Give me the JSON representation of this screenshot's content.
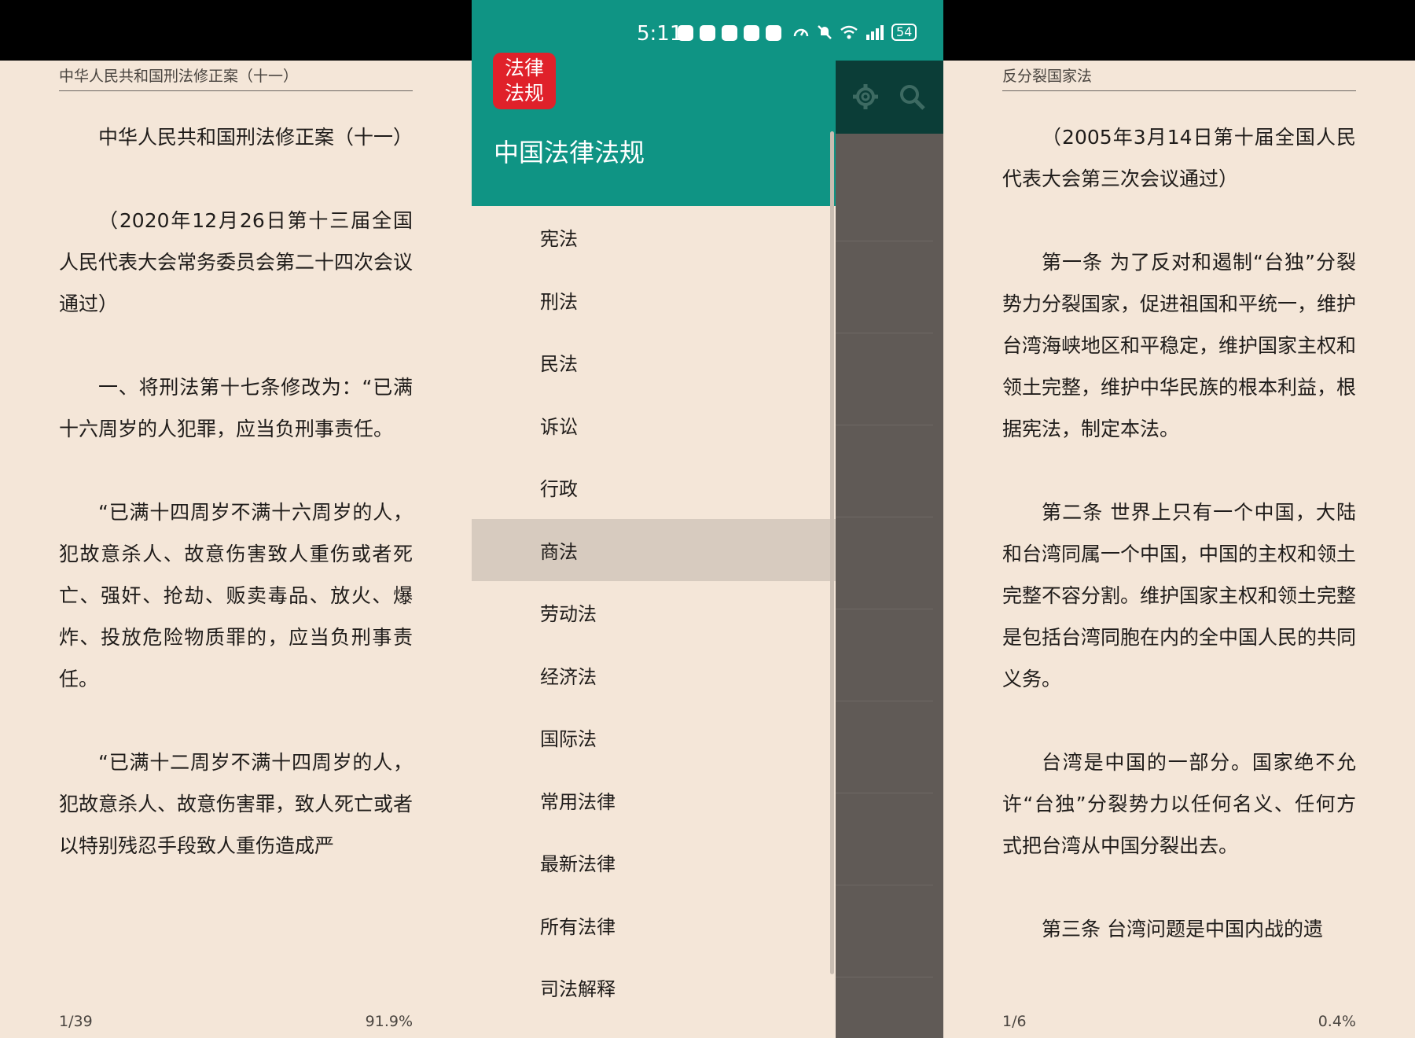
{
  "left_reader": {
    "running_title": "中华人民共和国刑法修正案（十一）",
    "paragraphs": [
      "中华人民共和国刑法修正案（十一）",
      "（2020年12月26日第十三届全国人民代表大会常务委员会第二十四次会议通过）",
      "一、将刑法第十七条修改为：“已满十六周岁的人犯罪，应当负刑事责任。",
      "“已满十四周岁不满十六周岁的人，犯故意杀人、故意伤害致人重伤或者死亡、强奸、抢劫、贩卖毒品、放火、爆炸、投放危险物质罪的，应当负刑事责任。",
      "“已满十二周岁不满十四周岁的人，犯故意杀人、故意伤害罪，致人死亡或者以特别残忍手段致人重伤造成严"
    ],
    "page": "1/39",
    "percent": "91.9%"
  },
  "status_bar": {
    "time": "5:11",
    "battery": "54"
  },
  "drawer": {
    "logo_lines": [
      "法律",
      "法规"
    ],
    "title": "中国法律法规",
    "items": [
      "宪法",
      "刑法",
      "民法",
      "诉讼",
      "行政",
      "商法",
      "劳动法",
      "经济法",
      "国际法",
      "常用法律",
      "最新法律",
      "所有法律",
      "司法解释"
    ],
    "active_item": "商法"
  },
  "icons": {
    "settings": "gear-icon",
    "search": "search-icon"
  },
  "right_reader": {
    "running_title": "反分裂国家法",
    "paragraphs": [
      "（2005年3月14日第十届全国人民代表大会第三次会议通过）",
      "第一条 为了反对和遏制“台独”分裂势力分裂国家，促进祖国和平统一，维护台湾海峡地区和平稳定，维护国家主权和领土完整，维护中华民族的根本利益，根据宪法，制定本法。",
      "第二条 世界上只有一个中国，大陆和台湾同属一个中国，中国的主权和领土完整不容分割。维护国家主权和领土完整是包括台湾同胞在内的全中国人民的共同义务。",
      "台湾是中国的一部分。国家绝不允许“台独”分裂势力以任何名义、任何方式把台湾从中国分裂出去。",
      "第三条 台湾问题是中国内战的遗"
    ],
    "page": "1/6",
    "percent": "0.4%"
  },
  "colors": {
    "teal": "#0f9484",
    "paper": "#f4e6d8",
    "logo_red": "#e0212a"
  }
}
